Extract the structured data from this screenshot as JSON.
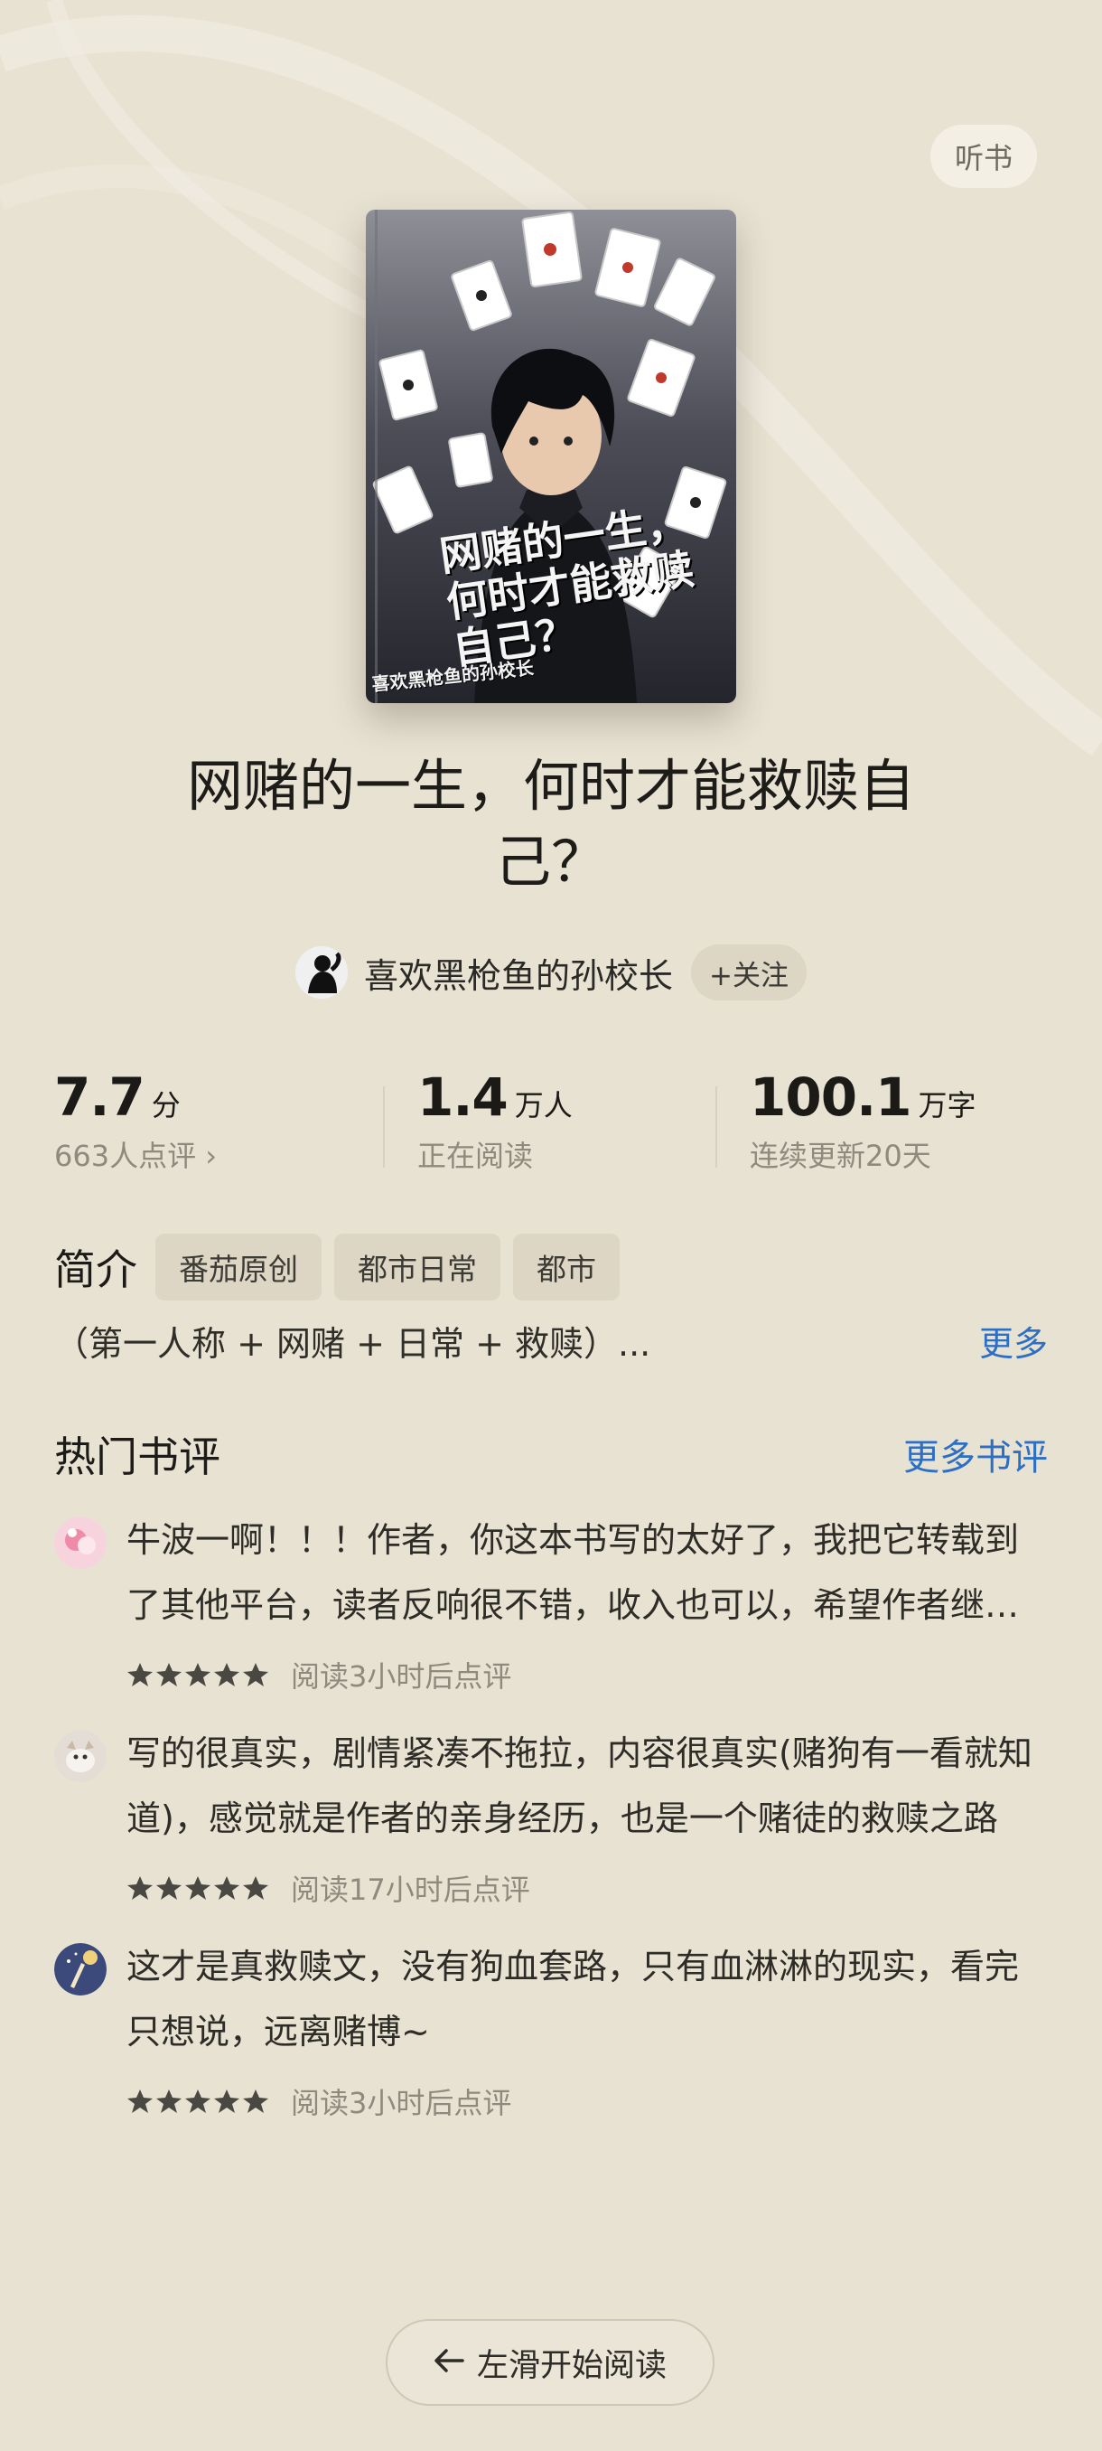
{
  "header": {
    "listen_label": "听书"
  },
  "cover": {
    "title_text": "网赌的一生，何时才能救赎自己？",
    "author_text": "喜欢黑枪鱼的孙校长"
  },
  "book": {
    "title": "网赌的一生，何时才能救赎自己？"
  },
  "author": {
    "name": "喜欢黑枪鱼的孙校长",
    "follow_label": "+关注"
  },
  "stats": {
    "rating": {
      "value": "7.7",
      "unit": "分",
      "sub": "663人点评 ›"
    },
    "readers": {
      "value": "1.4",
      "unit": "万人",
      "sub": "正在阅读"
    },
    "words": {
      "value": "100.1",
      "unit": "万字",
      "sub": "连续更新20天"
    }
  },
  "intro": {
    "label": "简介",
    "tags": [
      "番茄原创",
      "都市日常",
      "都市"
    ],
    "summary": "（第一人称 + 网赌 + 日常 + 救赎）...",
    "more_label": "更多"
  },
  "reviews": {
    "title": "热门书评",
    "more_label": "更多书评",
    "items": [
      {
        "text": "牛波一啊！！！作者，你这本书写的太好了，我把它转载到了其他平台，读者反响很不错，收入也可以，希望作者继续加油",
        "stars": 5,
        "meta": "阅读3小时后点评",
        "avatar_color": "#f6c9d6"
      },
      {
        "text": "写的很真实，剧情紧凑不拖拉，内容很真实(赌狗有一看就知道)，感觉就是作者的亲身经历，也是一个赌徒的救赎之路",
        "stars": 5,
        "meta": "阅读17小时后点评",
        "avatar_color": "#d9d2c9"
      },
      {
        "text": "这才是真救赎文，没有狗血套路，只有血淋淋的现实，看完只想说，远离赌博~",
        "stars": 5,
        "meta": "阅读3小时后点评",
        "avatar_color": "#3b4a7a"
      }
    ]
  },
  "footer": {
    "start_label": "左滑开始阅读"
  }
}
